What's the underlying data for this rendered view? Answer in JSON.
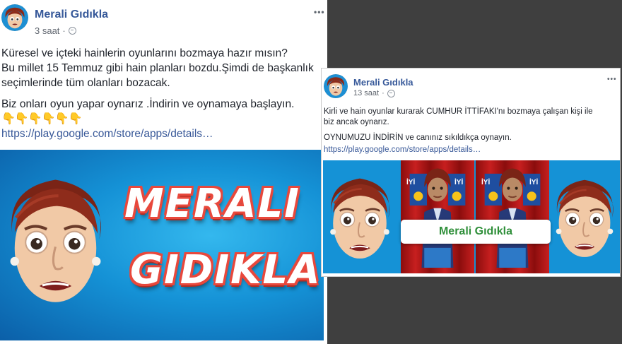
{
  "post_main": {
    "author": "Merali Gıdıkla",
    "time": "3 saat",
    "text_lines": [
      "Küresel ve içteki hainlerin oyunlarını bozmaya hazır mısın?",
      "Bu millet 15 Temmuz gibi hain planları bozdu.Şimdi de başkanlık",
      "seçimlerinde tüm olanları bozacak.",
      "Biz onları oyun yapar oynarız .İndirin ve oynamaya başlayın."
    ],
    "emoji": "👇👇👇👇👇👇",
    "link": "https://play.google.com/store/apps/details…",
    "banner_line1": "MERALI",
    "banner_line2": "GIDIKLA"
  },
  "post_second": {
    "author": "Merali Gıdıkla",
    "time": "13 saat",
    "text_lines": [
      "Kirli ve hain oyunlar kurarak CUMHUR İTTİFAKI'nı bozmaya çalışan kişi ile",
      "biz ancak oynarız.",
      "OYNUMUZU İNDİRİN ve canınız sıkıldıkça oynayın."
    ],
    "link": "https://play.google.com/store/apps/details…",
    "banner_title": "Merali Gıdıkla",
    "flag_text": "İYİ"
  },
  "more_icon": "•••",
  "colors": {
    "author": "#365899",
    "link": "#385898",
    "banner_blue": "#1592d6",
    "curtain_red": "#c71f1f",
    "logo_red": "#e8483c",
    "title_green": "#2f8f3a"
  }
}
